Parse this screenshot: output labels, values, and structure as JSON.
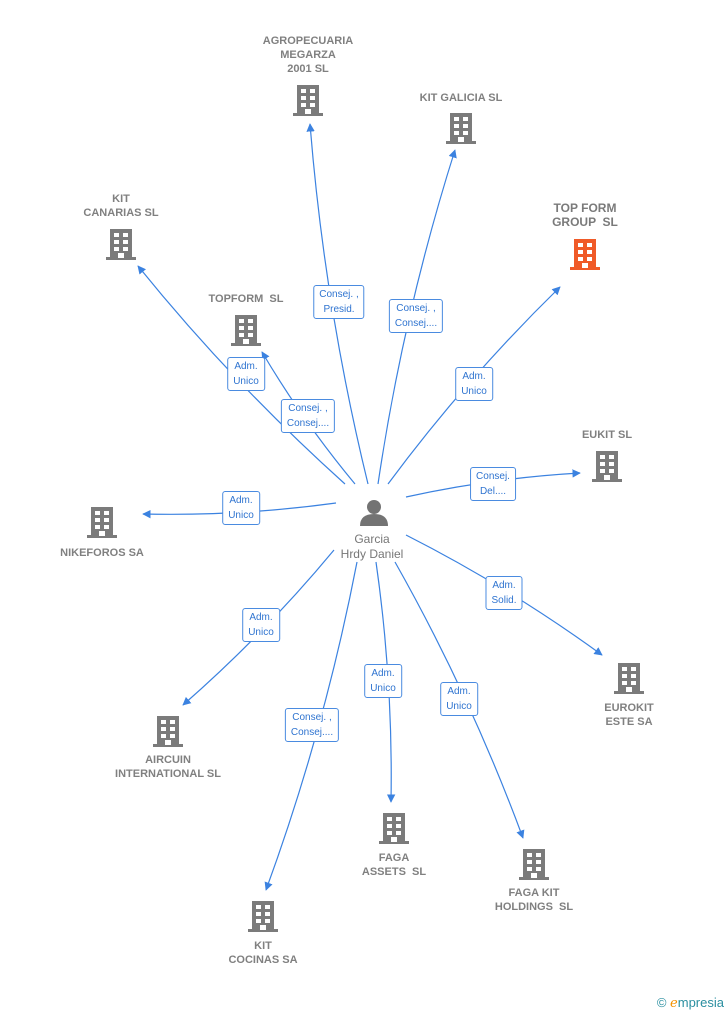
{
  "center": {
    "name": "Garcia\nHrdy Daniel",
    "icon": "person-icon"
  },
  "colors": {
    "edge": "#3b82e0",
    "node": "#7b7b7b",
    "highlight": "#f05a28"
  },
  "nodes": [
    {
      "name": "AGROPECUARIA\nMEGARZA\n2001 SL",
      "role": "Consej. ,\nPresid.",
      "highlight": false
    },
    {
      "name": "KIT GALICIA SL",
      "role": "Consej. ,\nConsej....",
      "highlight": false
    },
    {
      "name": "TOP FORM\nGROUP  SL",
      "role": "Adm.\nUnico",
      "highlight": true
    },
    {
      "name": "KIT\nCANARIAS SL",
      "role": "Adm.\nUnico",
      "highlight": false
    },
    {
      "name": "TOPFORM  SL",
      "role": "Consej. ,\nConsej....",
      "highlight": false
    },
    {
      "name": "EUKIT SL",
      "role": "Consej.\nDel....",
      "highlight": false
    },
    {
      "name": "NIKEFOROS SA",
      "role": "Adm.\nUnico",
      "highlight": false
    },
    {
      "name": "EUROKIT\nESTE SA",
      "role": "Adm.\nSolid.",
      "highlight": false
    },
    {
      "name": "AIRCUIN\nINTERNATIONAL SL",
      "role": "Adm.\nUnico",
      "highlight": false
    },
    {
      "name": "FAGA\nASSETS  SL",
      "role": "Adm.\nUnico",
      "highlight": false
    },
    {
      "name": "FAGA KIT\nHOLDINGS  SL",
      "role": "Adm.\nUnico",
      "highlight": false
    },
    {
      "name": "KIT\nCOCINAS SA",
      "role": "Consej. ,\nConsej....",
      "highlight": false
    }
  ],
  "footer": {
    "copyright": "©",
    "brand": "mpresia",
    "brand_initial": "e"
  }
}
